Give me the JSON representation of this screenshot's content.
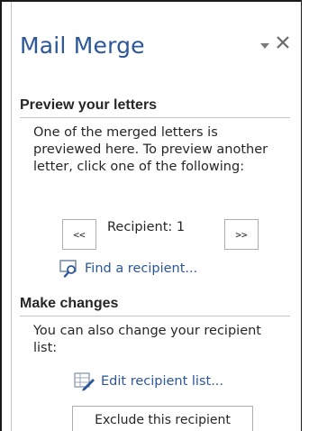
{
  "pane": {
    "title": "Mail Merge",
    "options_icon": "dropdown-triangle-icon",
    "close_icon": "close-icon"
  },
  "preview": {
    "header": "Preview your letters",
    "description": "One of the merged letters is previewed here. To preview another letter, click one of the following:",
    "prev_label": "<<",
    "next_label": ">>",
    "recipient_label": "Recipient: 1",
    "find_icon": "magnifier-icon",
    "find_link": "Find a recipient..."
  },
  "changes": {
    "header": "Make changes",
    "description": "You can also change your recipient list:",
    "edit_icon": "edit-list-icon",
    "edit_link": "Edit recipient list...",
    "exclude_button": "Exclude this recipient"
  },
  "colors": {
    "accent": "#2b579a",
    "text": "#262626",
    "divider": "#c6c6c6"
  }
}
